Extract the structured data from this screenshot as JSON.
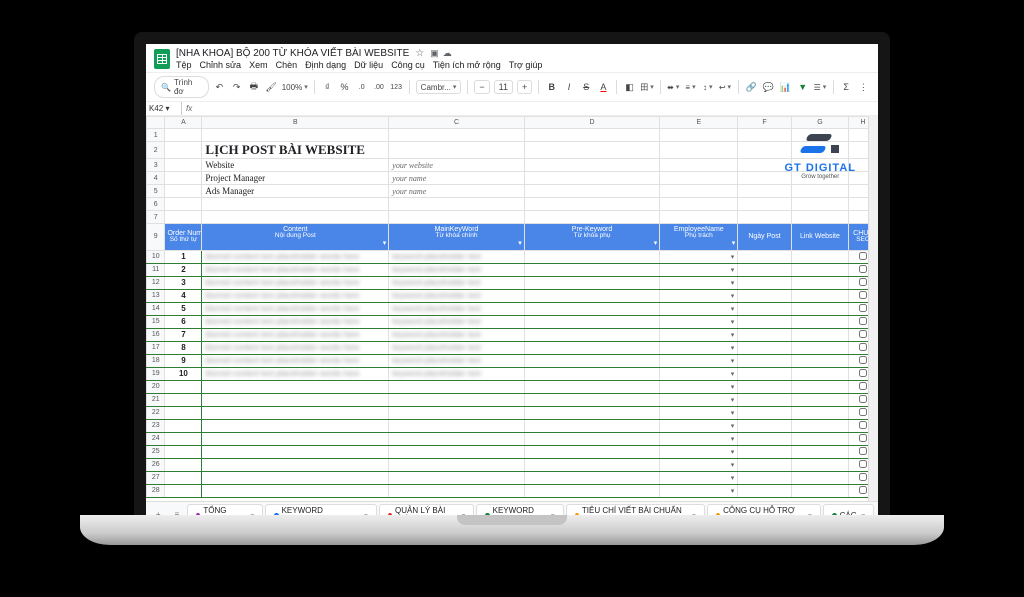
{
  "doc": {
    "title": "[NHA KHOA] BỘ 200 TỪ KHÓA VIẾT BÀI WEBSITE",
    "menu": [
      "Tệp",
      "Chỉnh sửa",
      "Xem",
      "Chèn",
      "Định dạng",
      "Dữ liệu",
      "Công cụ",
      "Tiện ích mở rộng",
      "Trợ giúp"
    ]
  },
  "toolbar": {
    "search_placeholder": "Trình đơ",
    "zoom": "100%",
    "currency": "₫",
    "percent": "%",
    "dec_dec": ".0",
    "dec_inc": ".00",
    "num_fmt": "123",
    "font": "Cambr...",
    "font_size": "11"
  },
  "namebox": {
    "cell": "K42",
    "fx": "fx"
  },
  "columns": [
    "",
    "A",
    "B",
    "C",
    "D",
    "E",
    "F",
    "G",
    "H"
  ],
  "sheet": {
    "title": "LỊCH POST BÀI WEBSITE",
    "meta": [
      {
        "label": "Website",
        "value": "your website"
      },
      {
        "label": "Project Manager",
        "value": "your name"
      },
      {
        "label": "Ads Manager",
        "value": "your name"
      }
    ],
    "logo": {
      "name": "GT DIGITAL",
      "tag": "Grow together"
    },
    "headers": [
      {
        "en": "Order Num",
        "vi": "Số thứ tự"
      },
      {
        "en": "Content",
        "vi": "Nội dung Post"
      },
      {
        "en": "MainKeyWord",
        "vi": "Từ khóa chính"
      },
      {
        "en": "Pre-Keyword",
        "vi": "Từ khóa phụ"
      },
      {
        "en": "EmployeeName",
        "vi": "Phụ trách"
      },
      {
        "en": "Ngày Post",
        "vi": ""
      },
      {
        "en": "Link Website",
        "vi": ""
      },
      {
        "en": "CHUẨ",
        "vi": "SEO"
      }
    ],
    "data_rows": [
      1,
      2,
      3,
      4,
      5,
      6,
      7,
      8,
      9,
      10
    ],
    "row_numbers_header": 9,
    "row_numbers_data_start": 10,
    "extra_row_start": 20,
    "extra_row_end": 28,
    "rownums_top": [
      1,
      2,
      3,
      4,
      5,
      6,
      7
    ]
  },
  "tabs": {
    "items": [
      {
        "label": "TỔNG QUAN",
        "color": "#9c27b0"
      },
      {
        "label": "KEYWORD RESEARCH",
        "color": "#1a73e8"
      },
      {
        "label": "QUẢN LÝ BÀI VIẾT",
        "color": "#d93025",
        "active": true
      },
      {
        "label": "KEYWORD MAP",
        "color": "#188038"
      },
      {
        "label": "TIÊU CHÍ VIẾT BÀI CHUẨN SEO",
        "color": "#f29900"
      },
      {
        "label": "CÔNG CỤ HỖ TRỢ SEO",
        "color": "#f29900"
      },
      {
        "label": "CÁC",
        "color": "#188038"
      }
    ]
  },
  "colors": {
    "header_blue": "#4a86e8",
    "grid_green": "#2e7d32"
  }
}
